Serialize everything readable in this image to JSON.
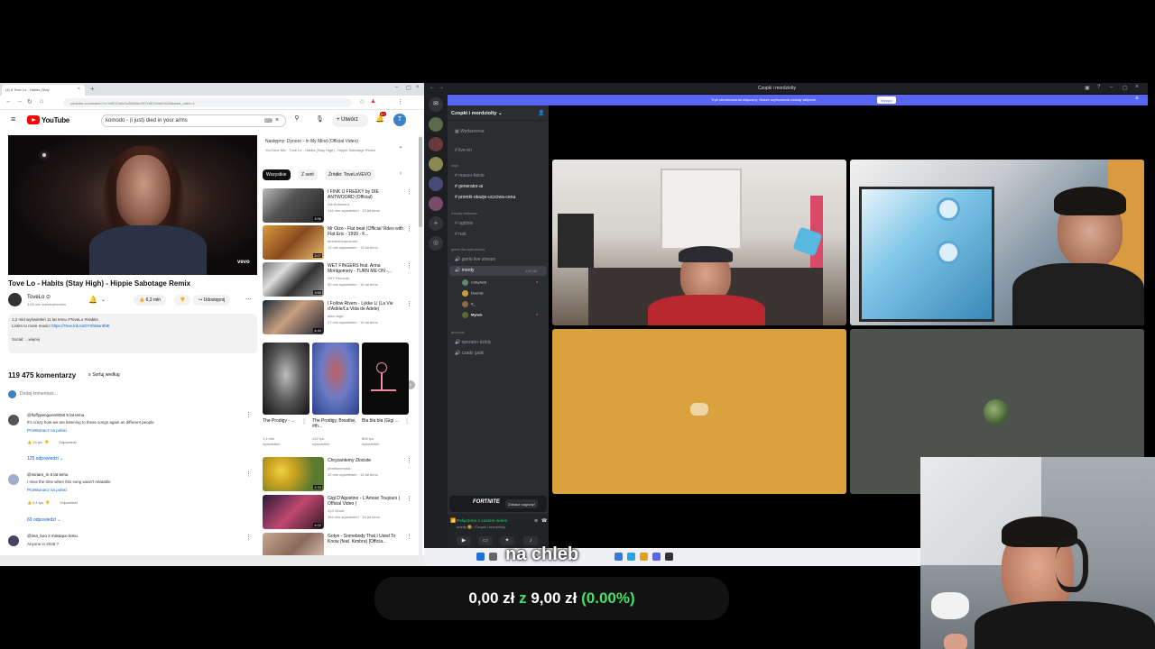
{
  "browser": {
    "tab_title": "(4) 8 Tove Lo - Habits (Stay",
    "url": "youtube.com/watch?v=YaEG2aWJnZ8&list=RDYaEG2aWJnZ8&start_radio=1",
    "yt_logo_text": "YouTube",
    "search_value": "komodo - (i just) died in your arms",
    "create_label": "Utwórz",
    "notif_count": "9+",
    "avatar_letter": "T",
    "video_title": "Tove Lo - Habits (Stay High) - Hippie Sabotage Remix",
    "vevo": "vevo",
    "channel_name": "ToveLo",
    "channel_subs": "3,63 mln subskrybentów",
    "likes": "6,2 mln",
    "share": "Udostępnij",
    "desc_line1": "1,2 mld wyświetleń  11 lat temu  #ToveLo #Habits",
    "desc_line2": "Listen to more music!",
    "desc_link": "https://Tove.lnk.to/DYShMonthlE",
    "desc_line3": "Social: ...więcej",
    "comments_count": "119 475 komentarzy",
    "sort_label": "Sortuj według",
    "add_comment": "Dodaj komentarz...",
    "comments": [
      {
        "user": "@fluffypenguins9250  5 lat temu",
        "text": "It's crazy how we are listening to these songs again as different people",
        "translate": "Przetłumacz na polski",
        "likes": "13 tys.",
        "reply": "Odpowiedz",
        "replies": "125 odpowiedzi"
      },
      {
        "user": "@miriam_m  6 lat temu",
        "text": "I miss the time when this song wasn't relatable",
        "translate": "Przetłumacz na polski",
        "likes": "4,4 tys.",
        "reply": "Odpowiedz",
        "replies": "69 odpowiedzi"
      },
      {
        "user": "@ima_boo  2 miesiące temu",
        "text": "Anyone in 2025 ?",
        "translate": "",
        "likes": "",
        "reply": "",
        "replies": ""
      }
    ],
    "up_next": "Następny: Dynoro - In My Mind (Official Video)",
    "up_next_meta": "YouTube Mix · Tove Lo - Habits (Stay High) - Hippie Sabotage Remix",
    "chips": [
      "Wszystkie",
      "Z serii",
      "Źródło: ToveLoVEVO"
    ],
    "recs": [
      {
        "title": "I FINK U FREEKY by DIE ANTWOORD (Official)",
        "channel": "Die Antwoord",
        "meta": "144 mln wyświetleń · 13 lat temu",
        "dur": "3:56"
      },
      {
        "title": "Mr Oizo - Flat beat (Official Video with Flat Eric - 1999 - F...",
        "channel": "ferenbsbioacoustic",
        "meta": "13 mln wyświetleń · 13 lat temu",
        "dur": "3:07"
      },
      {
        "title": "WET FINGERS feat. Anna Montgomery - TURN ME ON -...",
        "channel": "SKY Records",
        "meta": "30 mln wyświetleń · 10 lat temu",
        "dur": "3:55"
      },
      {
        "title": "I Follow Rivers - Lykke Li (La Vie d'Adèle/La Vida de Adele)",
        "channel": "aida nuge",
        "meta": "27 mln wyświetleń · 10 lat temu",
        "dur": "4:44"
      }
    ],
    "shelf": [
      {
        "title": "The Prodigy - ...",
        "meta1": "1,4 mln",
        "meta2": "wyświetleń"
      },
      {
        "title": "The Prodigy, Breathe, #th...",
        "meta1": "432 tys.",
        "meta2": "wyświetleń"
      },
      {
        "title": "Bla bla bla (Gigi ...",
        "meta1": "895 tys.",
        "meta2": "wyświetleń"
      }
    ],
    "recs2": [
      {
        "title": "Chryzantemy Złociste",
        "channel": "pearlsonmusic",
        "meta": "32 mln wyświetleń · 13 lat temu",
        "dur": "2:33"
      },
      {
        "title": "Gigi D'Agostino - L'Amour Toujours ( Official Video )",
        "channel": "ZyX Music",
        "meta": "354 mln wyświetleń · 16 lat temu",
        "dur": "4:02"
      },
      {
        "title": "Gotye - Somebody That I Used To Know (feat. Kimbra) [Officia...",
        "channel": "",
        "meta": "",
        "dur": ""
      }
    ]
  },
  "discord": {
    "window_title": "Czopki i mordziolty",
    "banner_text": "Tryb streamowania włączony. Nasze szyfrowania zostały aktywne.",
    "banner_button": "Wyłącz",
    "guild_name": "Czopki i mordziolty",
    "events": "Wydarzenia",
    "channels_top": [
      "live-on"
    ],
    "cat_wipe": "wipe",
    "channels_mid": [
      "maszo-farcie",
      "generator-ai",
      "promki-okazje-uczciwa-cena"
    ],
    "cat_text": "Kanały tekstowe",
    "channels_text": [
      "ogólnie",
      "rust"
    ],
    "cat_voice": "gierki dla wybrańców",
    "channels_voice": [
      "gierki live stream",
      "mordy"
    ],
    "voice_timer": "1:47:36",
    "voice_users": [
      "CobyAcid",
      "Doomis",
      "K_",
      "Mynek"
    ],
    "cat_voice2": "głosowe",
    "channels_voice2": [
      "operator dziidy",
      "czatki gatki"
    ],
    "fort_label": "FORTNITE",
    "fort_button": "Zobacz nagrody!",
    "vc_connected": "Połączono z czatem wideo",
    "vc_channel": "mordy 🤣 / Czopki i mordziolty",
    "user_name": "Mynek",
    "user_status": "Aktywny"
  },
  "overlay": {
    "subtitle": "na chleb",
    "counter_current": "0,00 zł",
    "counter_sep": "z",
    "counter_goal": "9,00 zł",
    "counter_pct": "(0.00%)"
  },
  "colors": {
    "youtube_red": "#ff0000",
    "discord_blurple": "#5865f2",
    "discord_green": "#23a55a",
    "tile_yellow": "#d9a23c",
    "tile_grey": "#4e524c",
    "counter_green": "#4ade6a"
  }
}
